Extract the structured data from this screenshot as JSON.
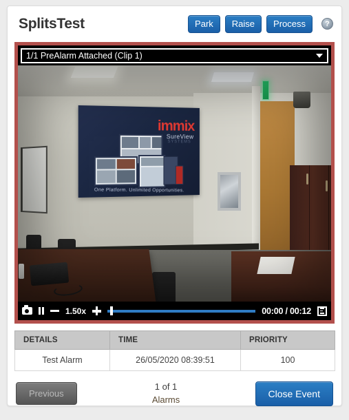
{
  "header": {
    "title": "SplitsTest",
    "buttons": [
      {
        "label": "Park",
        "name": "park-button"
      },
      {
        "label": "Raise",
        "name": "raise-button"
      },
      {
        "label": "Process",
        "name": "process-button"
      }
    ],
    "help": "?"
  },
  "clip_selector": {
    "selected": "1/1 PreAlarm Attached (Clip 1)"
  },
  "player": {
    "speed": "1.50x",
    "time": "00:00 / 00:12",
    "current_time": "00:00",
    "duration": "00:12",
    "progress_percent": 2,
    "state": "paused",
    "icons": {
      "snapshot": "camera-icon",
      "pause": "pause-icon",
      "slower": "minus-icon",
      "faster": "plus-icon",
      "playlist": "list-icon"
    }
  },
  "table": {
    "columns": [
      "DETAILS",
      "TIME",
      "PRIORITY"
    ],
    "rows": [
      {
        "details": "Test Alarm",
        "time": "26/05/2020 08:39:51",
        "priority": "100"
      }
    ]
  },
  "footer": {
    "previous_label": "Previous",
    "counter_line1": "1 of 1",
    "counter_line2": "Alarms",
    "close_label": "Close Event"
  },
  "colors": {
    "accent_blue": "#1a5fa8",
    "alert_red": "#b3504c",
    "header_gray": "#c8c8c8",
    "page_bg": "#ececec"
  }
}
